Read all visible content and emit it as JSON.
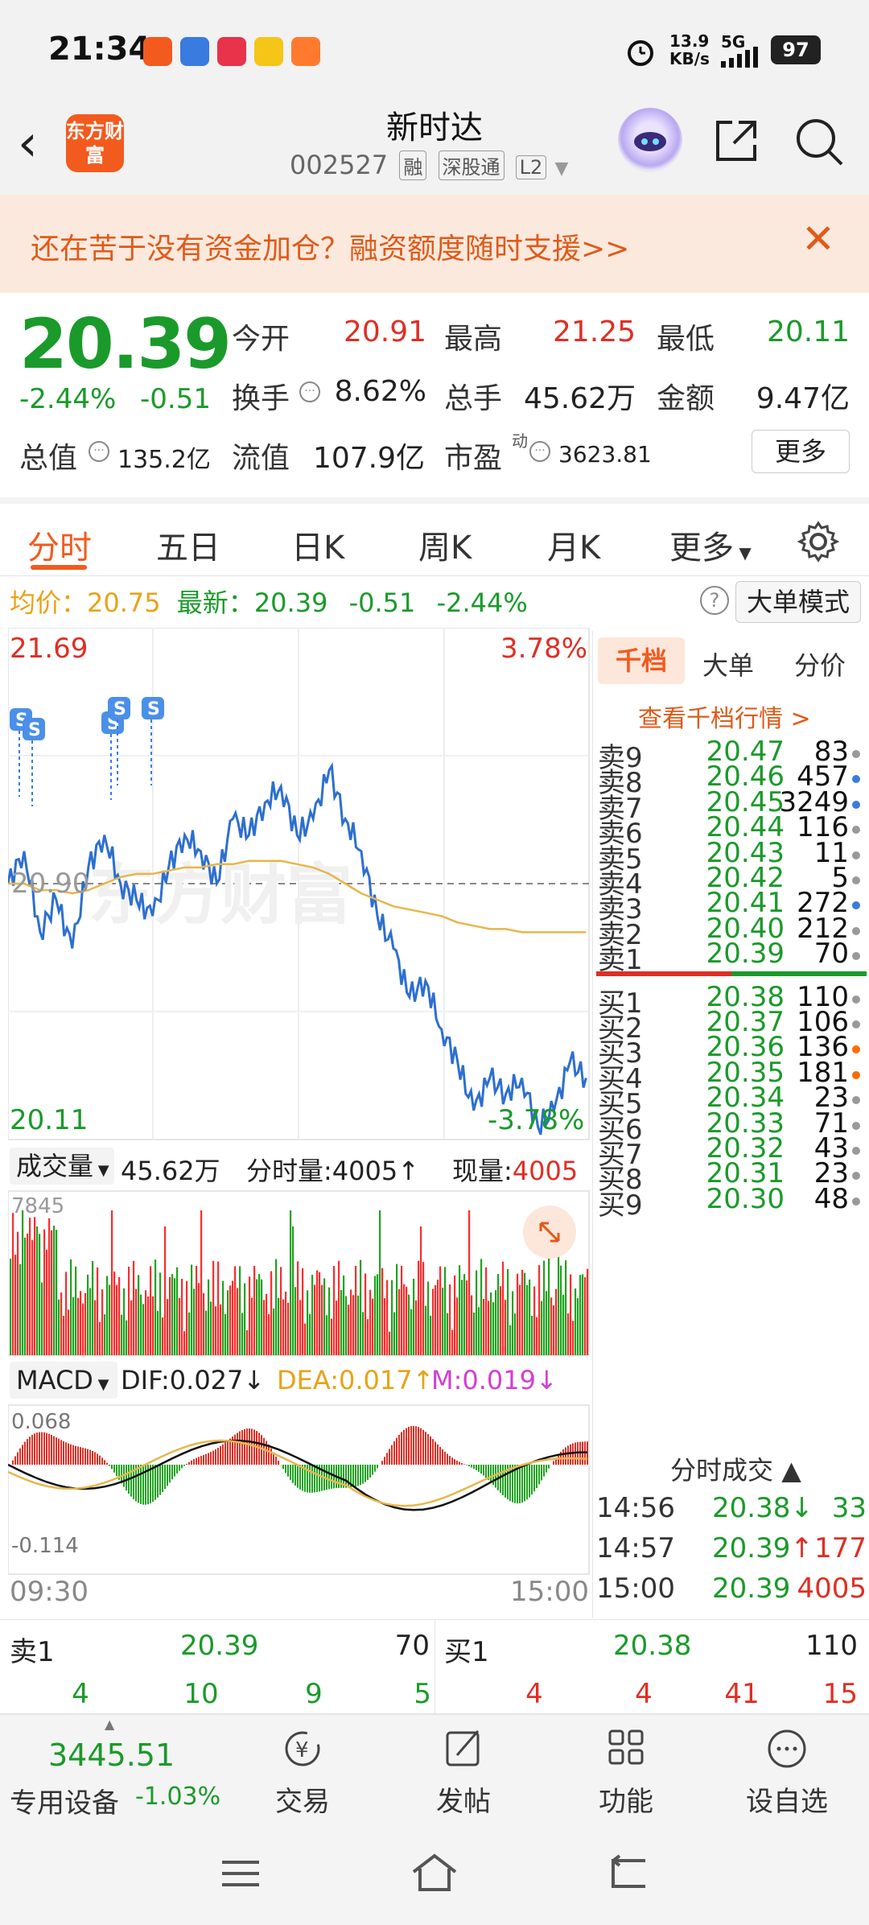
{
  "status_bar": {
    "time": "21:34",
    "net_speed_value": "13.9",
    "net_speed_unit": "KB/s",
    "network": "5G",
    "battery": "97",
    "icons": [
      "alarm-icon",
      "signal-icon"
    ]
  },
  "header": {
    "brand": "东方财富",
    "stock_name": "新时达",
    "stock_code": "002527",
    "tags": [
      "融",
      "深股通",
      "L2"
    ]
  },
  "banner": {
    "text": "还在苦于没有资金加仓？融资额度随时支援>>"
  },
  "quote": {
    "price": "20.39",
    "change_pct": "-2.44%",
    "change_amt": "-0.51",
    "open_label": "今开",
    "open": "20.91",
    "high_label": "最高",
    "high": "21.25",
    "low_label": "最低",
    "low": "20.11",
    "turnover_label": "换手",
    "turnover": "8.62%",
    "volume_label": "总手",
    "volume": "45.62万",
    "amount_label": "金额",
    "amount": "9.47亿",
    "mktcap_label": "总值",
    "mktcap": "135.2亿",
    "float_label": "流值",
    "float": "107.9亿",
    "pe_label": "市盈",
    "pe_sup": "动",
    "pe": "3623.81",
    "more": "更多"
  },
  "tabs": [
    "分时",
    "五日",
    "日K",
    "周K",
    "月K",
    "更多"
  ],
  "avg_row": {
    "avg_label": "均价：",
    "avg": "20.75",
    "last_label": "最新：",
    "last": "20.39",
    "chg": "-0.51",
    "pct": "-2.44%",
    "mode": "大单模式"
  },
  "chart": {
    "y_high": "21.69",
    "pct_high": "3.78%",
    "y_low": "20.11",
    "pct_low": "-3.78%",
    "mid_label": "20.90",
    "watermark": "东方财富",
    "vol_label": "成交量",
    "vol_total": "45.62万",
    "minute_vol": "分时量:4005↑",
    "now_label": "现量:",
    "now_vol": "4005",
    "vol_max": "7845",
    "macd_label": "MACD",
    "dif": "DIF:0.027↓",
    "dea": "DEA:0.017↑",
    "m": "M:0.019↓",
    "macd_high": "0.068",
    "macd_low": "-0.114",
    "t_start": "09:30",
    "t_end": "15:00"
  },
  "chart_data": {
    "type": "line",
    "x_range": [
      "09:30",
      "15:00"
    ],
    "ylim": [
      20.11,
      21.69
    ],
    "ref_price": 20.9,
    "series": [
      {
        "values": [
          20.9,
          21.0,
          20.75,
          20.85,
          20.7,
          20.95,
          21.05,
          20.9,
          20.85,
          20.8,
          20.95,
          21.05,
          21.0,
          20.9,
          21.1,
          21.05,
          21.15,
          21.2,
          21.05,
          21.1,
          21.25,
          21.1,
          21.0,
          20.8,
          20.7,
          20.55,
          20.6,
          20.45,
          20.35,
          20.2,
          20.3,
          20.25,
          20.3,
          20.15,
          20.2,
          20.35,
          20.3
        ]
      },
      {
        "values": [
          20.9,
          20.9,
          20.88,
          20.88,
          20.87,
          20.88,
          20.9,
          20.92,
          20.93,
          20.93,
          20.94,
          20.95,
          20.95,
          20.96,
          20.96,
          20.97,
          20.97,
          20.97,
          20.96,
          20.95,
          20.93,
          20.9,
          20.87,
          20.85,
          20.83,
          20.82,
          20.81,
          20.8,
          20.78,
          20.77,
          20.76,
          20.76,
          20.75,
          20.75,
          20.75,
          20.75,
          20.75
        ]
      }
    ]
  },
  "orderbook": {
    "tabs": [
      "千档",
      "大单",
      "分价"
    ],
    "link": "查看千档行情 >",
    "asks": [
      {
        "label": "卖9",
        "price": "20.47",
        "vol": "83",
        "dot": "#999999"
      },
      {
        "label": "卖8",
        "price": "20.46",
        "vol": "457",
        "dot": "#3a7be0"
      },
      {
        "label": "卖7",
        "price": "20.45",
        "vol": "3249",
        "dot": "#3a7be0"
      },
      {
        "label": "卖6",
        "price": "20.44",
        "vol": "116",
        "dot": "#999999"
      },
      {
        "label": "卖5",
        "price": "20.43",
        "vol": "11",
        "dot": "#999999"
      },
      {
        "label": "卖4",
        "price": "20.42",
        "vol": "5",
        "dot": "#999999"
      },
      {
        "label": "卖3",
        "price": "20.41",
        "vol": "272",
        "dot": "#3a7be0"
      },
      {
        "label": "卖2",
        "price": "20.40",
        "vol": "212",
        "dot": "#999999"
      },
      {
        "label": "卖1",
        "price": "20.39",
        "vol": "70",
        "dot": "#999999"
      }
    ],
    "bids": [
      {
        "label": "买1",
        "price": "20.38",
        "vol": "110",
        "dot": "#999999"
      },
      {
        "label": "买2",
        "price": "20.37",
        "vol": "106",
        "dot": "#999999"
      },
      {
        "label": "买3",
        "price": "20.36",
        "vol": "136",
        "dot": "#ff6a00"
      },
      {
        "label": "买4",
        "price": "20.35",
        "vol": "181",
        "dot": "#ff6a00"
      },
      {
        "label": "买5",
        "price": "20.34",
        "vol": "23",
        "dot": "#999999"
      },
      {
        "label": "买6",
        "price": "20.33",
        "vol": "71",
        "dot": "#999999"
      },
      {
        "label": "买7",
        "price": "20.32",
        "vol": "43",
        "dot": "#999999"
      },
      {
        "label": "买8",
        "price": "20.31",
        "vol": "23",
        "dot": "#999999"
      },
      {
        "label": "买9",
        "price": "20.30",
        "vol": "48",
        "dot": "#999999"
      }
    ],
    "trades_title": "分时成交",
    "trades": [
      {
        "time": "14:56",
        "price": "20.38↓",
        "vol": "33"
      },
      {
        "time": "14:57",
        "price": "20.39↑",
        "vol": "177"
      },
      {
        "time": "15:00",
        "price": "20.39",
        "vol": "4005"
      }
    ]
  },
  "bottom_quotes": {
    "sell_label": "卖1",
    "sell_price": "20.39",
    "sell_vol": "70",
    "buy_label": "买1",
    "buy_price": "20.38",
    "buy_vol": "110",
    "sell_queue": [
      "4",
      "10",
      "9",
      "5"
    ],
    "buy_queue": [
      "4",
      "4",
      "41",
      "15"
    ]
  },
  "bottom_nav": {
    "index_value": "3445.51",
    "index_label": "专用设备",
    "index_pct": "-1.03%",
    "items": [
      "交易",
      "发帖",
      "功能",
      "设自选"
    ]
  },
  "colors": {
    "accent": "#f25a1e",
    "up": "#e02e24",
    "down": "#1a9a2a",
    "price_line": "#2d6fd0",
    "avg_line": "#e8b64a"
  }
}
